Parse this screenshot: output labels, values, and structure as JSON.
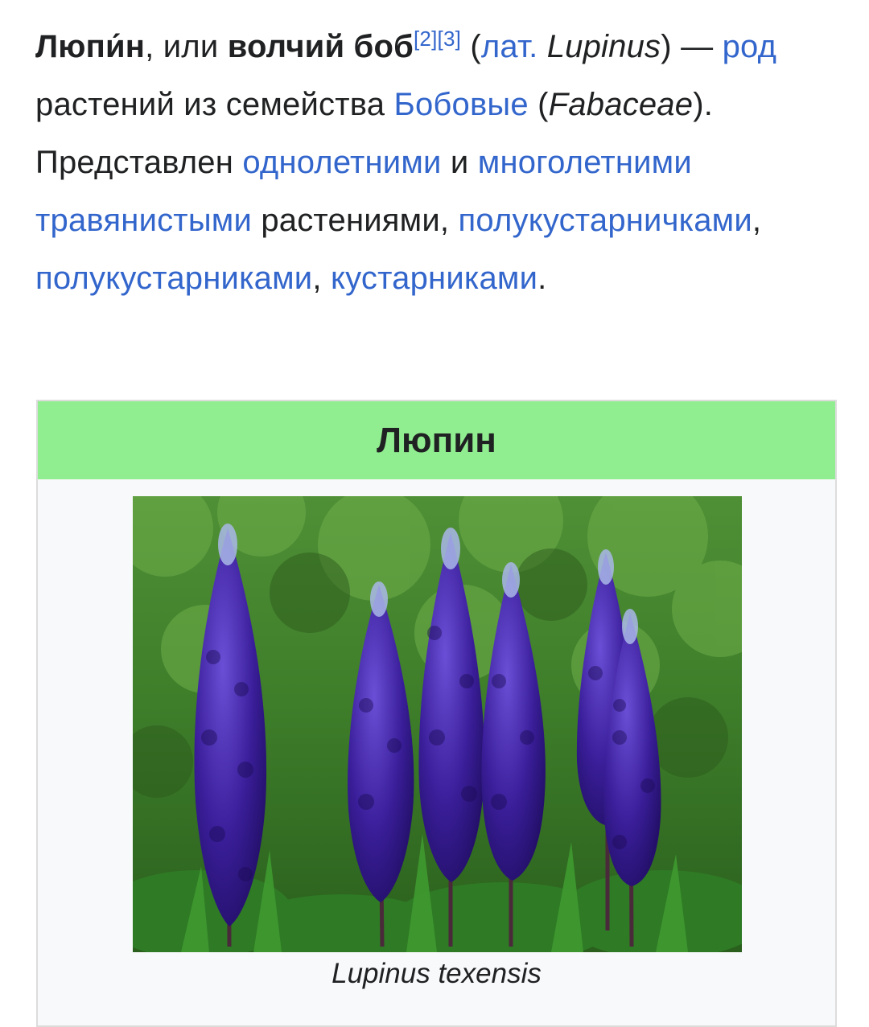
{
  "article": {
    "title_word": "Люпи́н",
    "text_or": ", или ",
    "alt_name": "волчий боб",
    "ref_2": "[2]",
    "ref_3": "[3]",
    "lat_open": " (",
    "lat_link": "лат.",
    "lat_space": " ",
    "lat_name": "Lupinus",
    "lat_close": ") — ",
    "genus_link": "род",
    "text_family": " растений из семейства ",
    "family_link": "Бобовые",
    "family_open": " (",
    "family_latin": "Fabaceae",
    "family_close": ").",
    "text_represented": " Представлен ",
    "annual_link": "однолетними",
    "text_and": " и ",
    "perennial_link": "многолетними",
    "space": " ",
    "herbaceous_link": "травянистыми",
    "text_plants": " растениями, ",
    "subshrublet_link": "полукустарничками",
    "comma_space": ", ",
    "subshrub_link": "полукустарниками",
    "comma_space_2": ", ",
    "shrub_link": "кустарниками",
    "period": "."
  },
  "infobox": {
    "header": "Люпин",
    "image_caption": "Lupinus texensis"
  },
  "colors": {
    "link": "#3366cc",
    "header_bg": "#90ee90",
    "infobox_bg": "#f8f9fa",
    "text": "#202122"
  }
}
